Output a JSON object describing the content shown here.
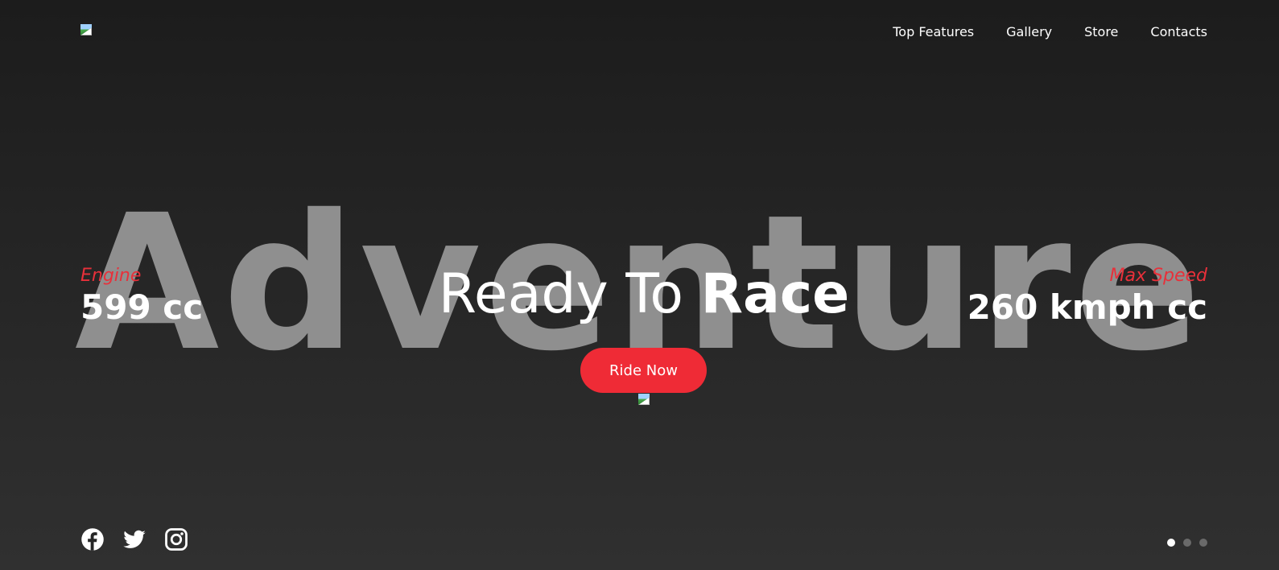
{
  "header": {
    "logo_icon": "broken-image-icon",
    "nav": [
      {
        "label": "Top Features"
      },
      {
        "label": "Gallery"
      },
      {
        "label": "Store"
      },
      {
        "label": "Contacts"
      }
    ]
  },
  "hero": {
    "background_word": "Adventure",
    "headline_light": "Ready To ",
    "headline_bold": "Race",
    "cta_label": "Ride Now",
    "engine": {
      "label": "Engine",
      "value": "599 cc"
    },
    "max_speed": {
      "label": "Max Speed",
      "value": "260 kmph cc"
    }
  },
  "social": [
    {
      "icon": "facebook-icon"
    },
    {
      "icon": "twitter-icon"
    },
    {
      "icon": "instagram-icon"
    }
  ],
  "slider": {
    "total": 3,
    "active_index": 0
  },
  "colors": {
    "accent": "#ef2b36",
    "background_top": "#1c1c1c",
    "background_bottom": "#303030",
    "watermark": "#8f8f8f"
  }
}
